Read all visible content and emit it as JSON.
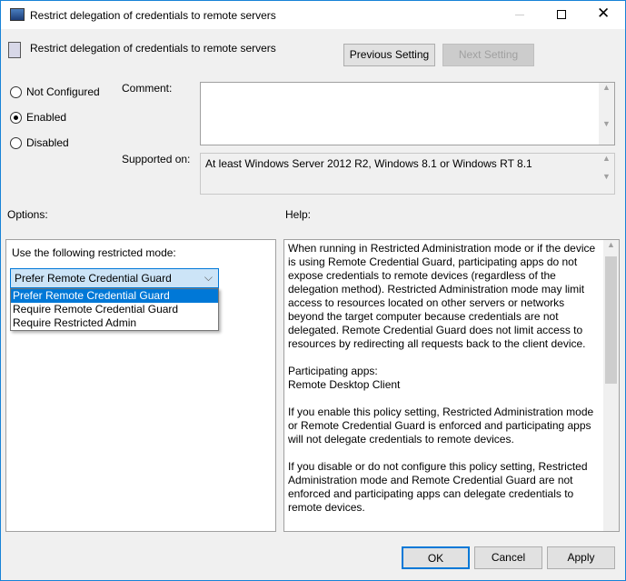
{
  "window": {
    "title": "Restrict delegation of credentials to remote servers"
  },
  "header": {
    "setting_name": "Restrict delegation of credentials to remote servers",
    "previous": "Previous Setting",
    "next": "Next Setting"
  },
  "state": {
    "options": [
      "Not Configured",
      "Enabled",
      "Disabled"
    ],
    "selected": "Enabled"
  },
  "comment": {
    "label": "Comment:",
    "value": ""
  },
  "supported": {
    "label": "Supported on:",
    "value": "At least Windows Server 2012 R2, Windows 8.1 or Windows RT 8.1"
  },
  "options_label": "Options:",
  "help_label": "Help:",
  "options": {
    "mode_label": "Use the following restricted mode:",
    "selected": "Prefer Remote Credential Guard",
    "items": [
      "Prefer Remote Credential Guard",
      "Require Remote Credential Guard",
      "Require Restricted Admin"
    ]
  },
  "help": [
    "When running in Restricted Administration mode or if the device is using Remote Credential Guard, participating apps do not expose credentials to remote devices (regardless of the delegation method). Restricted Administration mode may limit access to resources located on other servers or networks beyond the target computer because credentials are not delegated. Remote Credential Guard does not limit access to resources by redirecting all requests back to the client device.",
    "Participating apps:\nRemote Desktop Client",
    "If you enable this policy setting, Restricted Administration mode or Remote Credential Guard is enforced and participating apps will not delegate credentials to remote devices.",
    "If you disable or do not configure this policy setting, Restricted Administration mode and Remote Credential Guard are not enforced and participating apps can delegate credentials to remote devices."
  ],
  "footer": {
    "ok": "OK",
    "cancel": "Cancel",
    "apply": "Apply"
  }
}
